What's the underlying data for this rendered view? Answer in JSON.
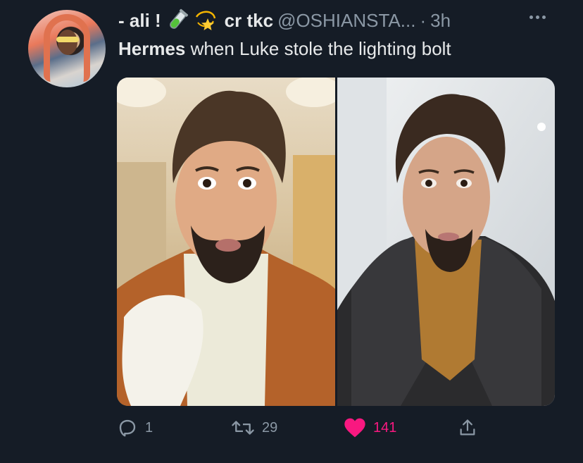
{
  "tweet": {
    "display_name": "- ali !",
    "emojis": [
      "test-tube-icon",
      "dizzy-star-icon"
    ],
    "secondary_name": "cr tkc",
    "handle": "@OSHIANSTA...",
    "separator": "·",
    "time": "3h",
    "text_bold": "Hermes",
    "text_rest": " when Luke stole the lighting bolt",
    "media_count": 2
  },
  "actions": {
    "reply_count": "1",
    "retweet_count": "29",
    "like_count": "141",
    "liked": true
  },
  "colors": {
    "background": "#151c26",
    "text_primary": "#e7e9ea",
    "text_secondary": "#8b98a5",
    "like_active": "#f91880"
  },
  "icons": {
    "reply": "reply-icon",
    "retweet": "retweet-icon",
    "like": "heart-icon",
    "share": "share-icon",
    "more": "more-icon"
  }
}
